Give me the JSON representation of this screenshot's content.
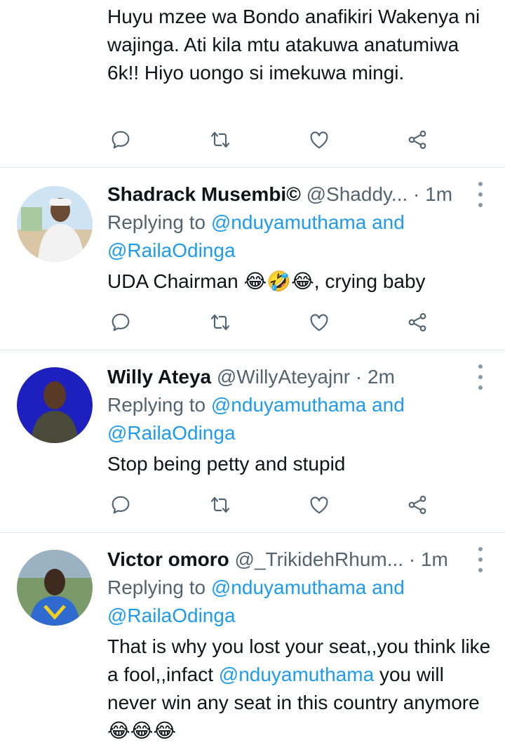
{
  "top_tweet": {
    "text": "Huyu mzee wa Bondo anafikiri Wakenya ni wajinga. Ati kila mtu atakuwa anatumiwa 6k!! Hiyo uongo si imekuwa mingi."
  },
  "tweets": [
    {
      "name": "Shadrack Musembi©",
      "handle": "@Shaddy...",
      "dot": " · ",
      "time": "1m",
      "replying_prefix": "Replying to ",
      "replying_user1": "@nduyamuthama",
      "replying_and": " and",
      "replying_user2": "@RailaOdinga",
      "text": "UDA Chairman 😂🤣😂, crying baby"
    },
    {
      "name": "Willy Ateya",
      "handle": "@WillyAteyajnr",
      "dot": " · ",
      "time": "2m",
      "replying_prefix": "Replying to ",
      "replying_user1": "@nduyamuthama",
      "replying_and": " and",
      "replying_user2": "@RailaOdinga",
      "text": "Stop being petty and stupid"
    },
    {
      "name": "Victor omoro",
      "handle": "@_TrikidehRhum...",
      "dot": " · ",
      "time": "1m",
      "replying_prefix": "Replying to ",
      "replying_user1": "@nduyamuthama",
      "replying_and": " and",
      "replying_user2": "@RailaOdinga",
      "text_part1": "That is why you lost your seat,,you think like a fool,,infact ",
      "text_mention": "@nduyamuthama",
      "text_part2": " you will never win any seat in this country anymore😂😂😂"
    }
  ],
  "icons": {
    "reply": "reply-icon",
    "retweet": "retweet-icon",
    "like": "heart-icon",
    "share": "share-icon",
    "more": "more-icon"
  },
  "colors": {
    "link": "#1d9bf0",
    "secondary": "#536471",
    "icon": "#536471"
  }
}
